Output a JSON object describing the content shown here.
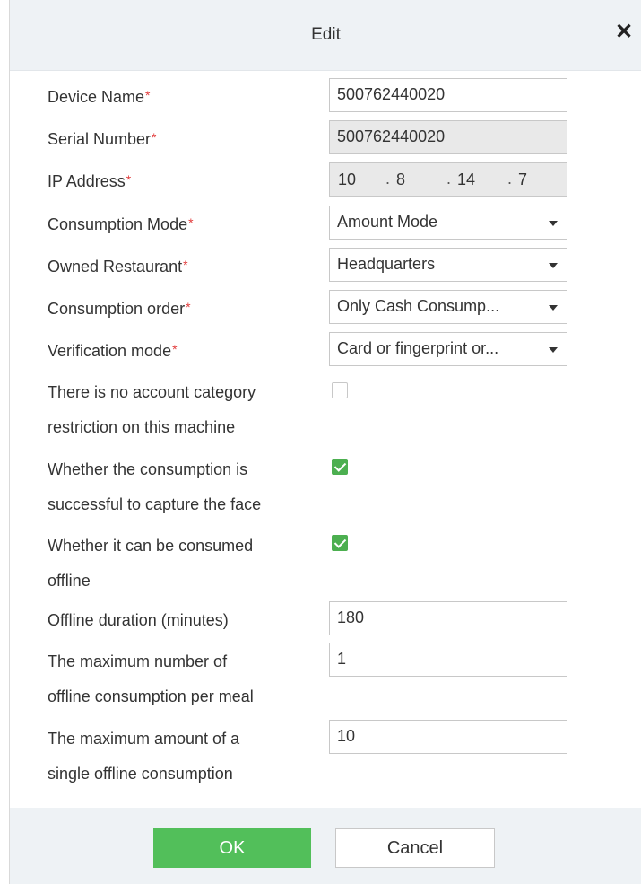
{
  "dialog": {
    "title": "Edit",
    "close_symbol": "✕",
    "required_mark": "*"
  },
  "fields": {
    "device_name": {
      "label": "Device Name",
      "value": "500762440020"
    },
    "serial_number": {
      "label": "Serial Number",
      "value": "500762440020"
    },
    "ip_address": {
      "label": "IP Address",
      "seg1": "10",
      "seg2": "8",
      "seg3": "14",
      "seg4": "7",
      "dot": "."
    },
    "consumption_mode": {
      "label": "Consumption Mode",
      "value": "Amount Mode"
    },
    "owned_restaurant": {
      "label": "Owned Restaurant",
      "value": "Headquarters"
    },
    "consumption_order": {
      "label": "Consumption order",
      "value": "Only Cash Consump..."
    },
    "verification_mode": {
      "label": "Verification mode",
      "value": "Card or fingerprint or..."
    },
    "no_account_restriction": {
      "label_line1": "There is no account category",
      "label_line2": "restriction on this machine",
      "checked": false
    },
    "capture_face": {
      "label_line1": "Whether the consumption is",
      "label_line2": "successful to capture the face",
      "checked": true
    },
    "consume_offline": {
      "label_line1": "Whether it can be consumed",
      "label_line2": "offline",
      "checked": true
    },
    "offline_duration": {
      "label": "Offline duration (minutes)",
      "value": "180"
    },
    "max_offline_count": {
      "label_line1": "The maximum number of",
      "label_line2": "offline consumption per meal",
      "value": "1"
    },
    "max_offline_amount": {
      "label_line1": "The maximum amount of a",
      "label_line2": "single offline consumption",
      "value": "10"
    }
  },
  "footer": {
    "ok_label": "OK",
    "cancel_label": "Cancel"
  },
  "colors": {
    "accent_green": "#52bf5a",
    "required_red": "#e23b3b",
    "header_bg": "#eef2f5"
  }
}
